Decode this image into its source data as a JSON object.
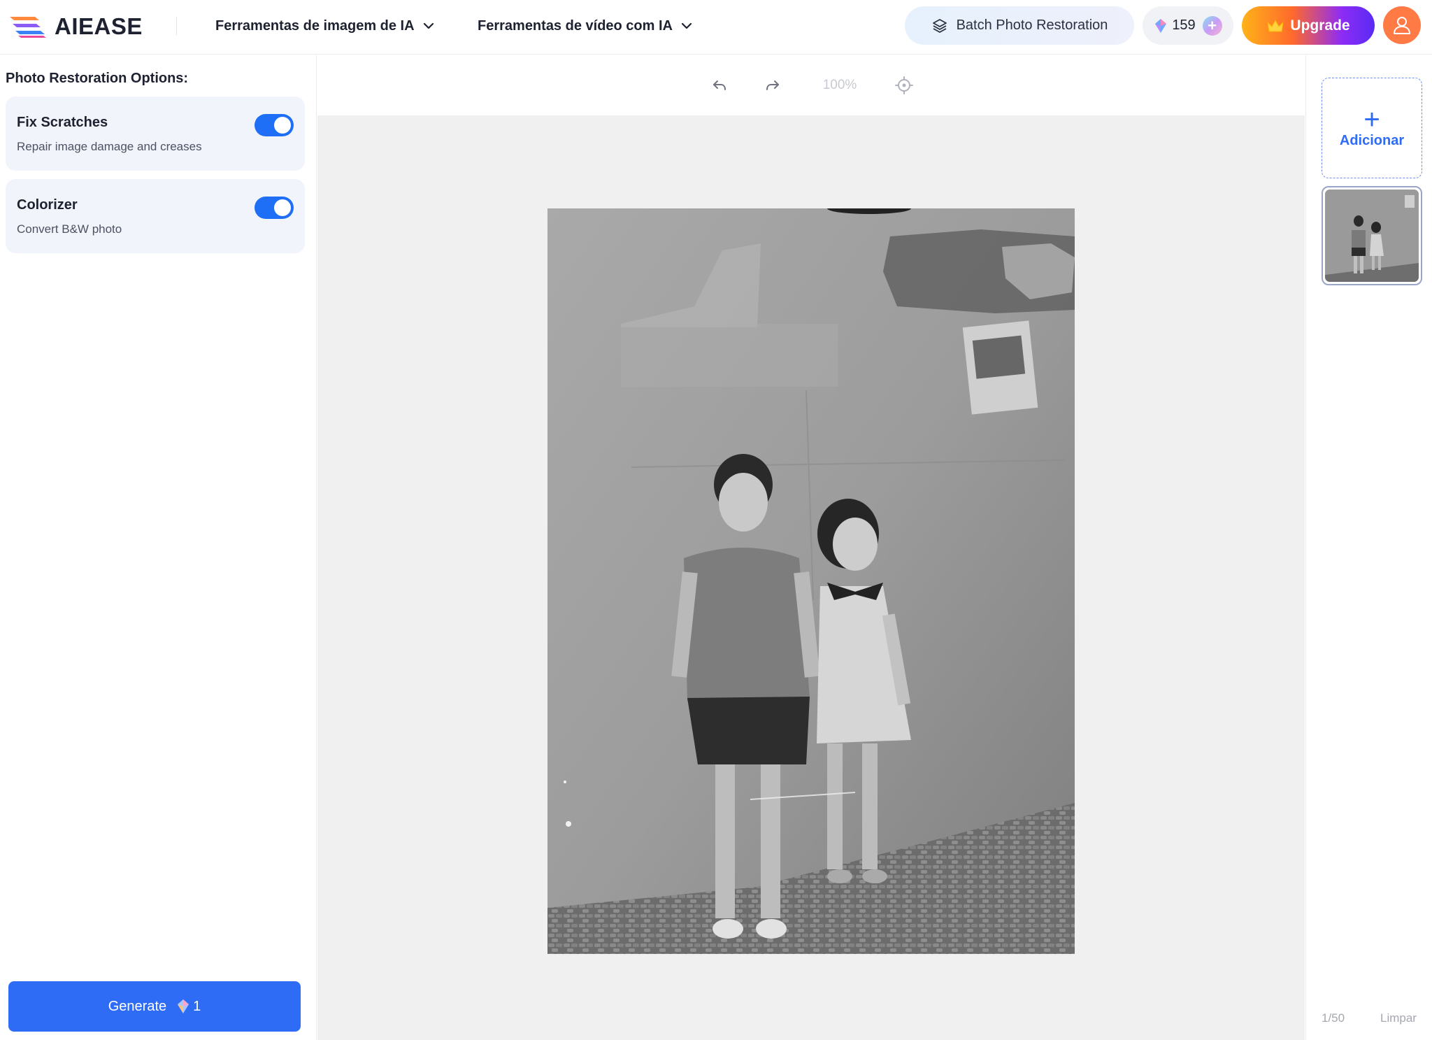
{
  "header": {
    "brand": "AIEASE",
    "nav": [
      {
        "label": "Ferramentas de imagem de IA"
      },
      {
        "label": "Ferramentas de vídeo com IA"
      }
    ],
    "batch_button": "Batch Photo Restoration",
    "credits": "159",
    "upgrade_button": "Upgrade"
  },
  "left_panel": {
    "title": "Photo Restoration Options:",
    "options": [
      {
        "title": "Fix Scratches",
        "description": "Repair image damage and creases",
        "enabled": true
      },
      {
        "title": "Colorizer",
        "description": "Convert B&W photo",
        "enabled": true
      }
    ],
    "generate_label": "Generate",
    "generate_cost": "1"
  },
  "toolbar": {
    "zoom": "100%"
  },
  "right_panel": {
    "add_label": "Adicionar",
    "page_count": "1/50",
    "clear_label": "Limpar"
  },
  "colors": {
    "accent": "#2e6cf6",
    "toggle_on": "#1f6ef6",
    "avatar": "#ff7a45"
  },
  "icons": {
    "undo": "undo-icon",
    "redo": "redo-icon",
    "locate": "crosshair-icon",
    "layers": "layers-icon",
    "gem": "gem-icon",
    "crown": "crown-icon",
    "user": "user-icon"
  }
}
